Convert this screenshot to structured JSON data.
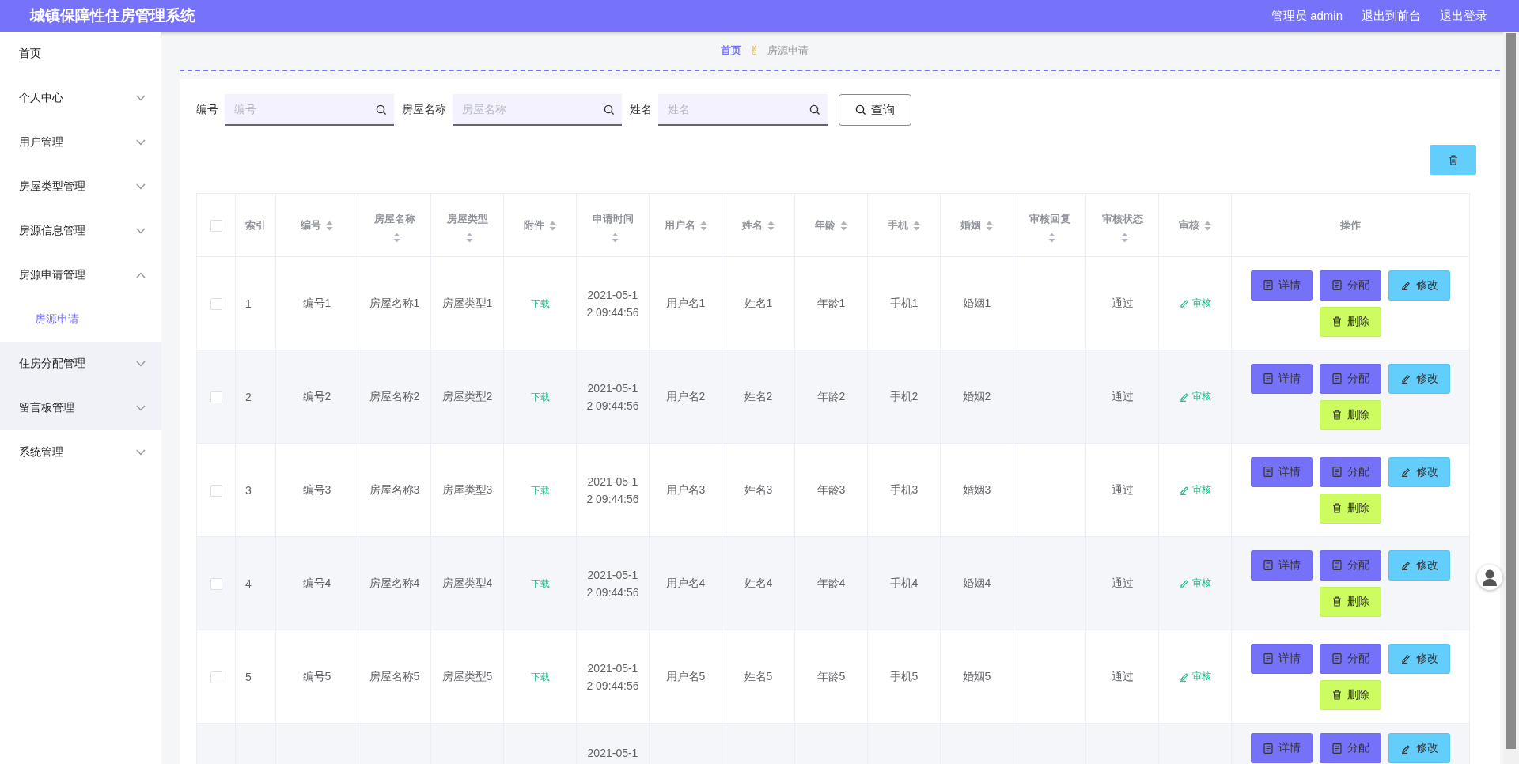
{
  "header": {
    "title": "城镇保障性住房管理系统",
    "links": [
      "管理员 admin",
      "退出到前台",
      "退出登录"
    ]
  },
  "sidebar": {
    "items": [
      {
        "label": "首页",
        "shaded": false
      },
      {
        "label": "个人中心",
        "expanded": false,
        "shaded": false
      },
      {
        "label": "用户管理",
        "expanded": false,
        "shaded": false
      },
      {
        "label": "房屋类型管理",
        "expanded": false,
        "shaded": false
      },
      {
        "label": "房源信息管理",
        "expanded": false,
        "shaded": false
      },
      {
        "label": "房源申请管理",
        "expanded": true,
        "shaded": false,
        "children": [
          {
            "label": "房源申请",
            "selected": true
          }
        ]
      },
      {
        "label": "住房分配管理",
        "expanded": false,
        "shaded": true
      },
      {
        "label": "留言板管理",
        "expanded": false,
        "shaded": true
      },
      {
        "label": "系统管理",
        "expanded": false,
        "shaded": false
      }
    ]
  },
  "breadcrumb": {
    "separator": "✌",
    "items": [
      {
        "label": "首页",
        "current": false
      },
      {
        "label": "房源申请",
        "current": true
      }
    ]
  },
  "search": {
    "fields": [
      {
        "label": "编号",
        "placeholder": "编号"
      },
      {
        "label": "房屋名称",
        "placeholder": "房屋名称"
      },
      {
        "label": "姓名",
        "placeholder": "姓名"
      }
    ],
    "button": "查询"
  },
  "table": {
    "columns": [
      {
        "kind": "checkbox",
        "checked": false
      },
      {
        "kind": "text",
        "label": "索引"
      },
      {
        "kind": "text",
        "label": "编号",
        "sortable": true
      },
      {
        "kind": "text",
        "label": "房屋名称",
        "sortable": true
      },
      {
        "kind": "text",
        "label": "房屋类型",
        "sortable": true
      },
      {
        "kind": "text",
        "label": "附件",
        "sortable": true
      },
      {
        "kind": "text",
        "label": "申请时间",
        "sortable": true
      },
      {
        "kind": "text",
        "label": "用户名",
        "sortable": true
      },
      {
        "kind": "text",
        "label": "姓名",
        "sortable": true
      },
      {
        "kind": "text",
        "label": "年龄",
        "sortable": true
      },
      {
        "kind": "text",
        "label": "手机",
        "sortable": true
      },
      {
        "kind": "text",
        "label": "婚姻",
        "sortable": true
      },
      {
        "kind": "text",
        "label": "审核回复",
        "sortable": true
      },
      {
        "kind": "text",
        "label": "审核状态",
        "sortable": true
      },
      {
        "kind": "text",
        "label": "审核",
        "sortable": true
      },
      {
        "kind": "text",
        "label": "操作"
      }
    ],
    "rows": [
      {
        "selected": false,
        "index": "1",
        "number": "编号1",
        "house_name": "房屋名称1",
        "house_type": "房屋类型1",
        "attachment": "下载",
        "time": "2021-05-12 09:44:56",
        "username": "用户名1",
        "name": "姓名1",
        "age": "年龄1",
        "phone": "手机1",
        "marriage": "婚姻1",
        "review_status": "通过",
        "review": "审核",
        "actions": [
          {
            "kind": "detail",
            "label": "详情"
          },
          {
            "kind": "assign",
            "label": "分配"
          },
          {
            "kind": "edit",
            "label": "修改"
          },
          {
            "kind": "delete",
            "label": "删除"
          }
        ]
      },
      {
        "selected": false,
        "index": "2",
        "number": "编号2",
        "house_name": "房屋名称2",
        "house_type": "房屋类型2",
        "attachment": "下载",
        "time": "2021-05-12 09:44:56",
        "username": "用户名2",
        "name": "姓名2",
        "age": "年龄2",
        "phone": "手机2",
        "marriage": "婚姻2",
        "review_status": "通过",
        "review": "审核",
        "actions": [
          {
            "kind": "detail",
            "label": "详情"
          },
          {
            "kind": "assign",
            "label": "分配"
          },
          {
            "kind": "edit",
            "label": "修改"
          },
          {
            "kind": "delete",
            "label": "删除"
          }
        ]
      },
      {
        "selected": false,
        "index": "3",
        "number": "编号3",
        "house_name": "房屋名称3",
        "house_type": "房屋类型3",
        "attachment": "下载",
        "time": "2021-05-12 09:44:56",
        "username": "用户名3",
        "name": "姓名3",
        "age": "年龄3",
        "phone": "手机3",
        "marriage": "婚姻3",
        "review_status": "通过",
        "review": "审核",
        "actions": [
          {
            "kind": "detail",
            "label": "详情"
          },
          {
            "kind": "assign",
            "label": "分配"
          },
          {
            "kind": "edit",
            "label": "修改"
          },
          {
            "kind": "delete",
            "label": "删除"
          }
        ]
      },
      {
        "selected": false,
        "index": "4",
        "number": "编号4",
        "house_name": "房屋名称4",
        "house_type": "房屋类型4",
        "attachment": "下载",
        "time": "2021-05-12 09:44:56",
        "username": "用户名4",
        "name": "姓名4",
        "age": "年龄4",
        "phone": "手机4",
        "marriage": "婚姻4",
        "review_status": "通过",
        "review": "审核",
        "actions": [
          {
            "kind": "detail",
            "label": "详情"
          },
          {
            "kind": "assign",
            "label": "分配"
          },
          {
            "kind": "edit",
            "label": "修改"
          },
          {
            "kind": "delete",
            "label": "删除"
          }
        ]
      },
      {
        "selected": false,
        "index": "5",
        "number": "编号5",
        "house_name": "房屋名称5",
        "house_type": "房屋类型5",
        "attachment": "下载",
        "time": "2021-05-12 09:44:56",
        "username": "用户名5",
        "name": "姓名5",
        "age": "年龄5",
        "phone": "手机5",
        "marriage": "婚姻5",
        "review_status": "通过",
        "review": "审核",
        "actions": [
          {
            "kind": "detail",
            "label": "详情"
          },
          {
            "kind": "assign",
            "label": "分配"
          },
          {
            "kind": "edit",
            "label": "修改"
          },
          {
            "kind": "delete",
            "label": "删除"
          }
        ]
      },
      {
        "time": "2021-05-1",
        "actions": [
          {
            "kind": "detail",
            "label": "详情"
          },
          {
            "kind": "assign",
            "label": "分配"
          },
          {
            "kind": "edit",
            "label": "修改"
          }
        ]
      }
    ]
  }
}
